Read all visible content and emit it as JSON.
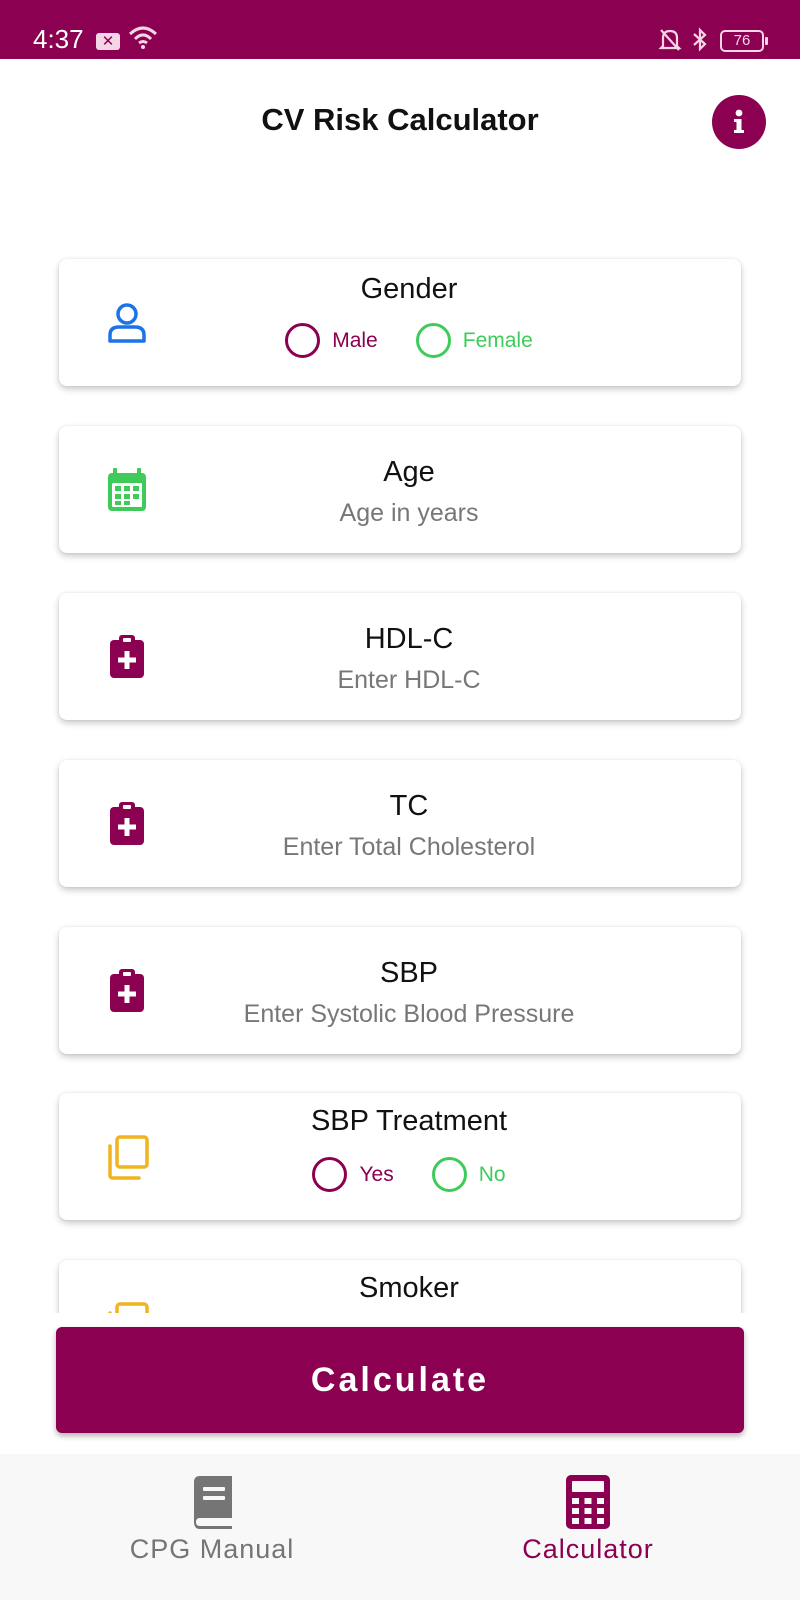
{
  "status_bar": {
    "time": "4:37",
    "battery": "76"
  },
  "header": {
    "title": "CV Risk Calculator"
  },
  "form": {
    "gender": {
      "label": "Gender",
      "options": [
        "Male",
        "Female"
      ]
    },
    "age": {
      "label": "Age",
      "placeholder": "Age in years"
    },
    "hdl": {
      "label": "HDL-C",
      "placeholder": "Enter HDL-C"
    },
    "tc": {
      "label": "TC",
      "placeholder": "Enter Total Cholesterol"
    },
    "sbp": {
      "label": "SBP",
      "placeholder": "Enter Systolic Blood Pressure"
    },
    "sbp_treatment": {
      "label": "SBP Treatment",
      "options": [
        "Yes",
        "No"
      ]
    },
    "smoker": {
      "label": "Smoker"
    }
  },
  "calculate_button": "Calculate",
  "bottom_nav": {
    "items": [
      {
        "label": "CPG Manual"
      },
      {
        "label": "Calculator"
      }
    ]
  },
  "colors": {
    "primary": "#8b0050",
    "secondary": "#3ecb5a",
    "person_icon": "#1a73e8",
    "calendar_icon": "#3ecb5a",
    "copy_icon": "#f0b41e"
  }
}
